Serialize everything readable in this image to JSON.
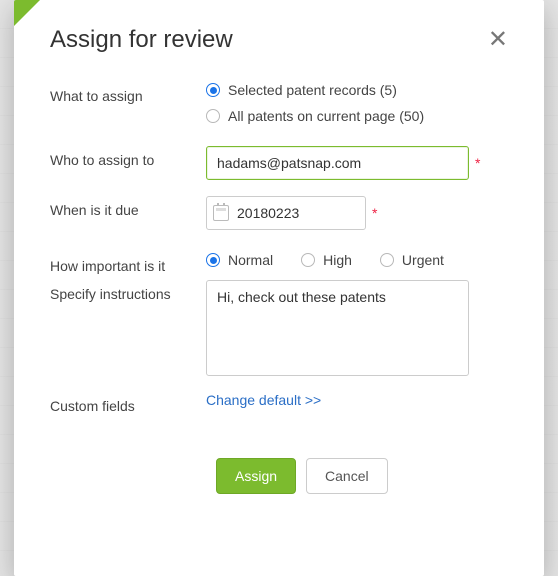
{
  "modal": {
    "title": "Assign for review"
  },
  "form": {
    "what_label": "What to assign",
    "what_options": {
      "selected": "Selected patent records (5)",
      "all": "All patents on current page (50)"
    },
    "who_label": "Who to assign to",
    "who_value": "hadams@patsnap.com",
    "due_label": "When is it due",
    "due_value": "20180223",
    "importance_label": "How important is it",
    "importance_options": {
      "normal": "Normal",
      "high": "High",
      "urgent": "Urgent"
    },
    "instructions_label": "Specify instructions",
    "instructions_value": "Hi, check out these patents",
    "custom_label": "Custom fields",
    "custom_link": "Change default >>"
  },
  "actions": {
    "assign": "Assign",
    "cancel": "Cancel"
  },
  "required_marker": "*"
}
